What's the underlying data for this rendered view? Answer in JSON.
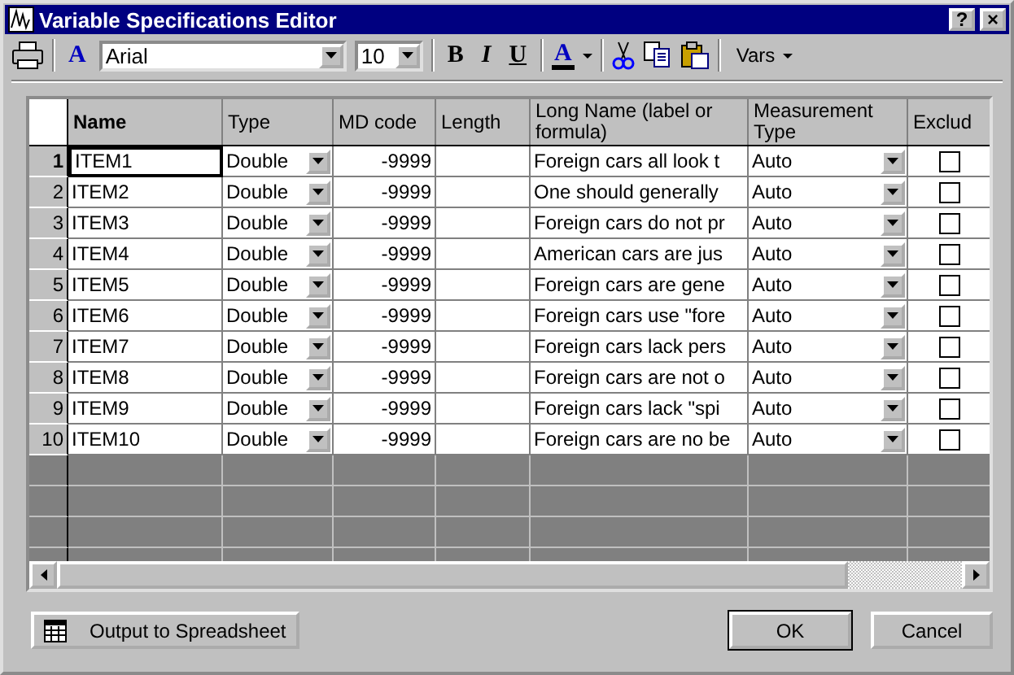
{
  "window": {
    "title": "Variable Specifications Editor",
    "help_button": "?",
    "close_button": "×"
  },
  "toolbar": {
    "font_glyph": "A",
    "font_name": "Arial",
    "font_size": "10",
    "bold": "B",
    "italic": "I",
    "underline": "U",
    "color_glyph": "A",
    "vars": "Vars"
  },
  "table": {
    "columns": [
      "Name",
      "Type",
      "MD code",
      "Length",
      "Long Name (label or formula)",
      "Measurement Type",
      "Exclud"
    ],
    "rows": [
      {
        "number": "1",
        "name": "ITEM1",
        "selected": true,
        "type": "Double",
        "md_code": "-9999",
        "long_name": "Foreign cars all look t",
        "measurement": "Auto",
        "exclude": false
      },
      {
        "number": "2",
        "name": "ITEM2",
        "selected": false,
        "type": "Double",
        "md_code": "-9999",
        "long_name": "One should generally",
        "measurement": "Auto",
        "exclude": false
      },
      {
        "number": "3",
        "name": "ITEM3",
        "selected": false,
        "type": "Double",
        "md_code": "-9999",
        "long_name": "Foreign cars do not pr",
        "measurement": "Auto",
        "exclude": false
      },
      {
        "number": "4",
        "name": "ITEM4",
        "selected": false,
        "type": "Double",
        "md_code": "-9999",
        "long_name": "American cars are jus",
        "measurement": "Auto",
        "exclude": false
      },
      {
        "number": "5",
        "name": "ITEM5",
        "selected": false,
        "type": "Double",
        "md_code": "-9999",
        "long_name": "Foreign cars are gene",
        "measurement": "Auto",
        "exclude": false
      },
      {
        "number": "6",
        "name": "ITEM6",
        "selected": false,
        "type": "Double",
        "md_code": "-9999",
        "long_name": "Foreign cars use \"fore",
        "measurement": "Auto",
        "exclude": false
      },
      {
        "number": "7",
        "name": "ITEM7",
        "selected": false,
        "type": "Double",
        "md_code": "-9999",
        "long_name": "Foreign cars lack pers",
        "measurement": "Auto",
        "exclude": false
      },
      {
        "number": "8",
        "name": "ITEM8",
        "selected": false,
        "type": "Double",
        "md_code": "-9999",
        "long_name": "Foreign cars are not o",
        "measurement": "Auto",
        "exclude": false
      },
      {
        "number": "9",
        "name": "ITEM9",
        "selected": false,
        "type": "Double",
        "md_code": "-9999",
        "long_name": "Foreign cars lack \"spi",
        "measurement": "Auto",
        "exclude": false
      },
      {
        "number": "10",
        "name": "ITEM10",
        "selected": false,
        "type": "Double",
        "md_code": "-9999",
        "long_name": "Foreign cars are no be",
        "measurement": "Auto",
        "exclude": false
      }
    ]
  },
  "buttons": {
    "output": "Output to Spreadsheet",
    "ok": "OK",
    "cancel": "Cancel"
  }
}
